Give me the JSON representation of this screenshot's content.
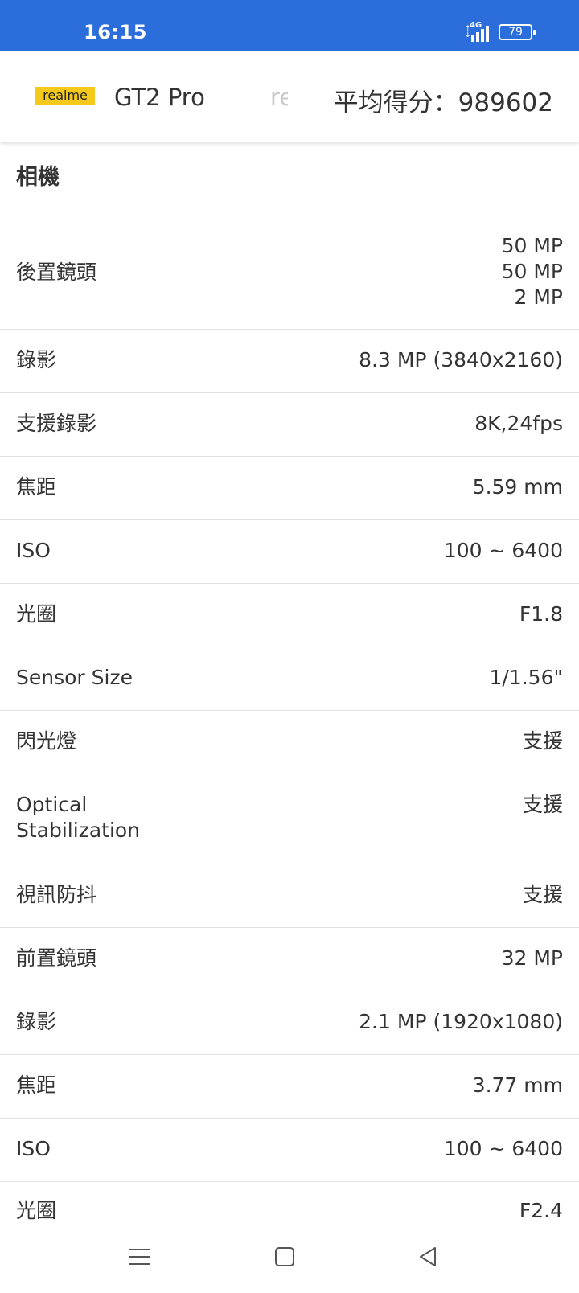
{
  "status_bar": {
    "time": "16:15",
    "network_label": "4G",
    "battery": "79"
  },
  "header": {
    "brand_logo": "realme",
    "device_name": "GT2 Pro",
    "faded_text": "re",
    "average_score": "平均得分：989602"
  },
  "section": {
    "title": "相機"
  },
  "specs": [
    {
      "label": "後置鏡頭",
      "value": [
        "50 MP",
        "50 MP",
        "2 MP"
      ]
    },
    {
      "label": "錄影",
      "value": [
        "8.3 MP (3840x2160)"
      ]
    },
    {
      "label": "支援錄影",
      "value": [
        "8K,24fps"
      ]
    },
    {
      "label": "焦距",
      "value": [
        "5.59 mm"
      ]
    },
    {
      "label": "ISO",
      "value": [
        "100 ~ 6400"
      ]
    },
    {
      "label": "光圈",
      "value": [
        "F1.8"
      ]
    },
    {
      "label": "Sensor Size",
      "value": [
        "1/1.56\""
      ]
    },
    {
      "label": "閃光燈",
      "value": [
        "支援"
      ]
    },
    {
      "label": [
        "Optical",
        "Stabilization"
      ],
      "value": [
        "支援"
      ]
    },
    {
      "label": "視訊防抖",
      "value": [
        "支援"
      ]
    },
    {
      "label": "前置鏡頭",
      "value": [
        "32 MP"
      ]
    },
    {
      "label": "錄影",
      "value": [
        "2.1 MP (1920x1080)"
      ]
    },
    {
      "label": "焦距",
      "value": [
        "3.77 mm"
      ]
    },
    {
      "label": "ISO",
      "value": [
        "100 ~ 6400"
      ]
    },
    {
      "label": "光圈",
      "value": [
        "F2.4"
      ]
    }
  ],
  "nav": {
    "icons": [
      "menu-icon",
      "home-icon",
      "back-icon"
    ]
  },
  "colors": {
    "status_bar": "#2a6ddb",
    "logo": "#f4c91b",
    "divider": "#e3e3e3"
  }
}
